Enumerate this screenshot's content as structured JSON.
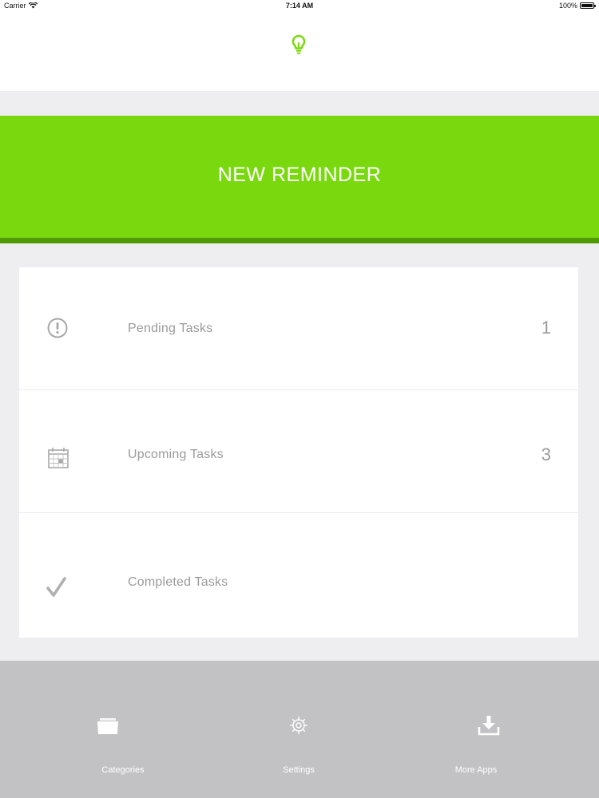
{
  "status_bar": {
    "carrier": "Carrier",
    "time": "7:14 AM",
    "battery": "100%"
  },
  "header": {
    "icon": "lightbulb-icon",
    "accent_color": "#7ad80f"
  },
  "banner": {
    "label": "NEW REMINDER",
    "background": "#7ad80f",
    "shadow": "#4f9a04"
  },
  "tasks": [
    {
      "label": "Pending Tasks",
      "count": "1",
      "icon": "alert-circle-icon"
    },
    {
      "label": "Upcoming Tasks",
      "count": "3",
      "icon": "calendar-icon"
    },
    {
      "label": "Completed Tasks",
      "count": "",
      "icon": "checkmark-icon"
    }
  ],
  "tab_bar": {
    "items": [
      {
        "label": "Categories",
        "icon": "folder-icon"
      },
      {
        "label": "Settings",
        "icon": "gear-icon"
      },
      {
        "label": "More Apps",
        "icon": "download-icon"
      }
    ]
  }
}
